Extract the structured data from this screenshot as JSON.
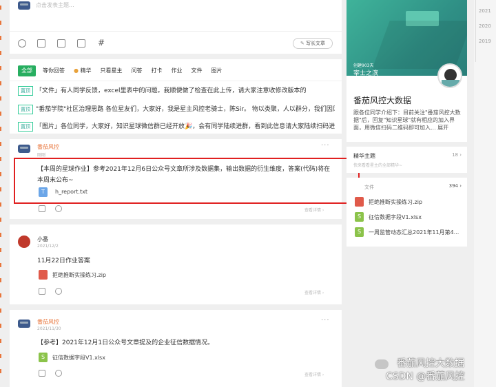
{
  "composer": {
    "placeholder": "点击发表主题...",
    "write_article": "写长文章"
  },
  "years": [
    "2021",
    "2020",
    "2019"
  ],
  "filter_tabs": [
    "全部",
    "等你回答",
    "精华",
    "只看星主",
    "问答",
    "打卡",
    "作业",
    "文件",
    "图片"
  ],
  "pinned": [
    {
      "tag": "置顶",
      "text": "「文件」有人同学反馈，excel里表中的问题。我顺便做了检查在此上传，请大家注意收修改版本的"
    },
    {
      "tag": "置顶",
      "text": "\"番茄学院\"社区治理思路 各位星友们，大家好，我是星主风控老骑士，陈Sir。 物以类聚，人以群分，我们因风控..."
    },
    {
      "tag": "置顶",
      "text": "「图片」各位同学，大家好，知识星球微信群已经开放🎉，会有同学陆续进群，看到此信息请大家陆续扫码进群..."
    }
  ],
  "posts": [
    {
      "author": "番茄风控",
      "date": "刚刚",
      "content_line1": "【本周的星球作业】参考2021年12月6日公众号文章所涉及数据集，输出数据的衍生维度，答案(代码)将在",
      "content_line2": "本周末公布~",
      "file_name": "h_report.txt",
      "detail_link": "查看详情 ›"
    },
    {
      "author": "小番",
      "date": "2021/12/2",
      "content_line1": "11月22日作业答案",
      "file_name": "拒绝推断实操练习.zip",
      "detail_link": "查看详情 ›"
    },
    {
      "author": "番茄风控",
      "date": "2021/11/30",
      "content_line1": "【参考】2021年12月1日公众号文章提及的企业征信数据情况。",
      "file_name": "征信数据字段V1.xlsx",
      "detail_link": "查看详情 ›"
    }
  ],
  "sidebar": {
    "created": "创建903天",
    "owner": "宰士之滨",
    "group_name": "番茄风控大数据",
    "description": "跟各位同学介绍下：目前关注\"番茄风控大数据\"后，回复\"知识星球\"就有相应的加入界面，用微信扫码二维码即可加入... 展开",
    "featured_title": "精华主题",
    "featured_count": "18 ›",
    "featured_sub": "快来看看星主的全部精华~",
    "files_title": "文件",
    "files_count": "394 ›",
    "files": [
      "拒绝推断实操练习.zip",
      "征信数据字段V1.xlsx",
      "一周监管动态汇总2021年11月第4..."
    ]
  },
  "watermark": {
    "line1": "番茄风控大数据",
    "line2": "CSDN @番茄风控"
  },
  "colors": {
    "accent_orange": "#e8753b",
    "highlight_red": "#e02020",
    "brand_green": "#27ae60"
  }
}
